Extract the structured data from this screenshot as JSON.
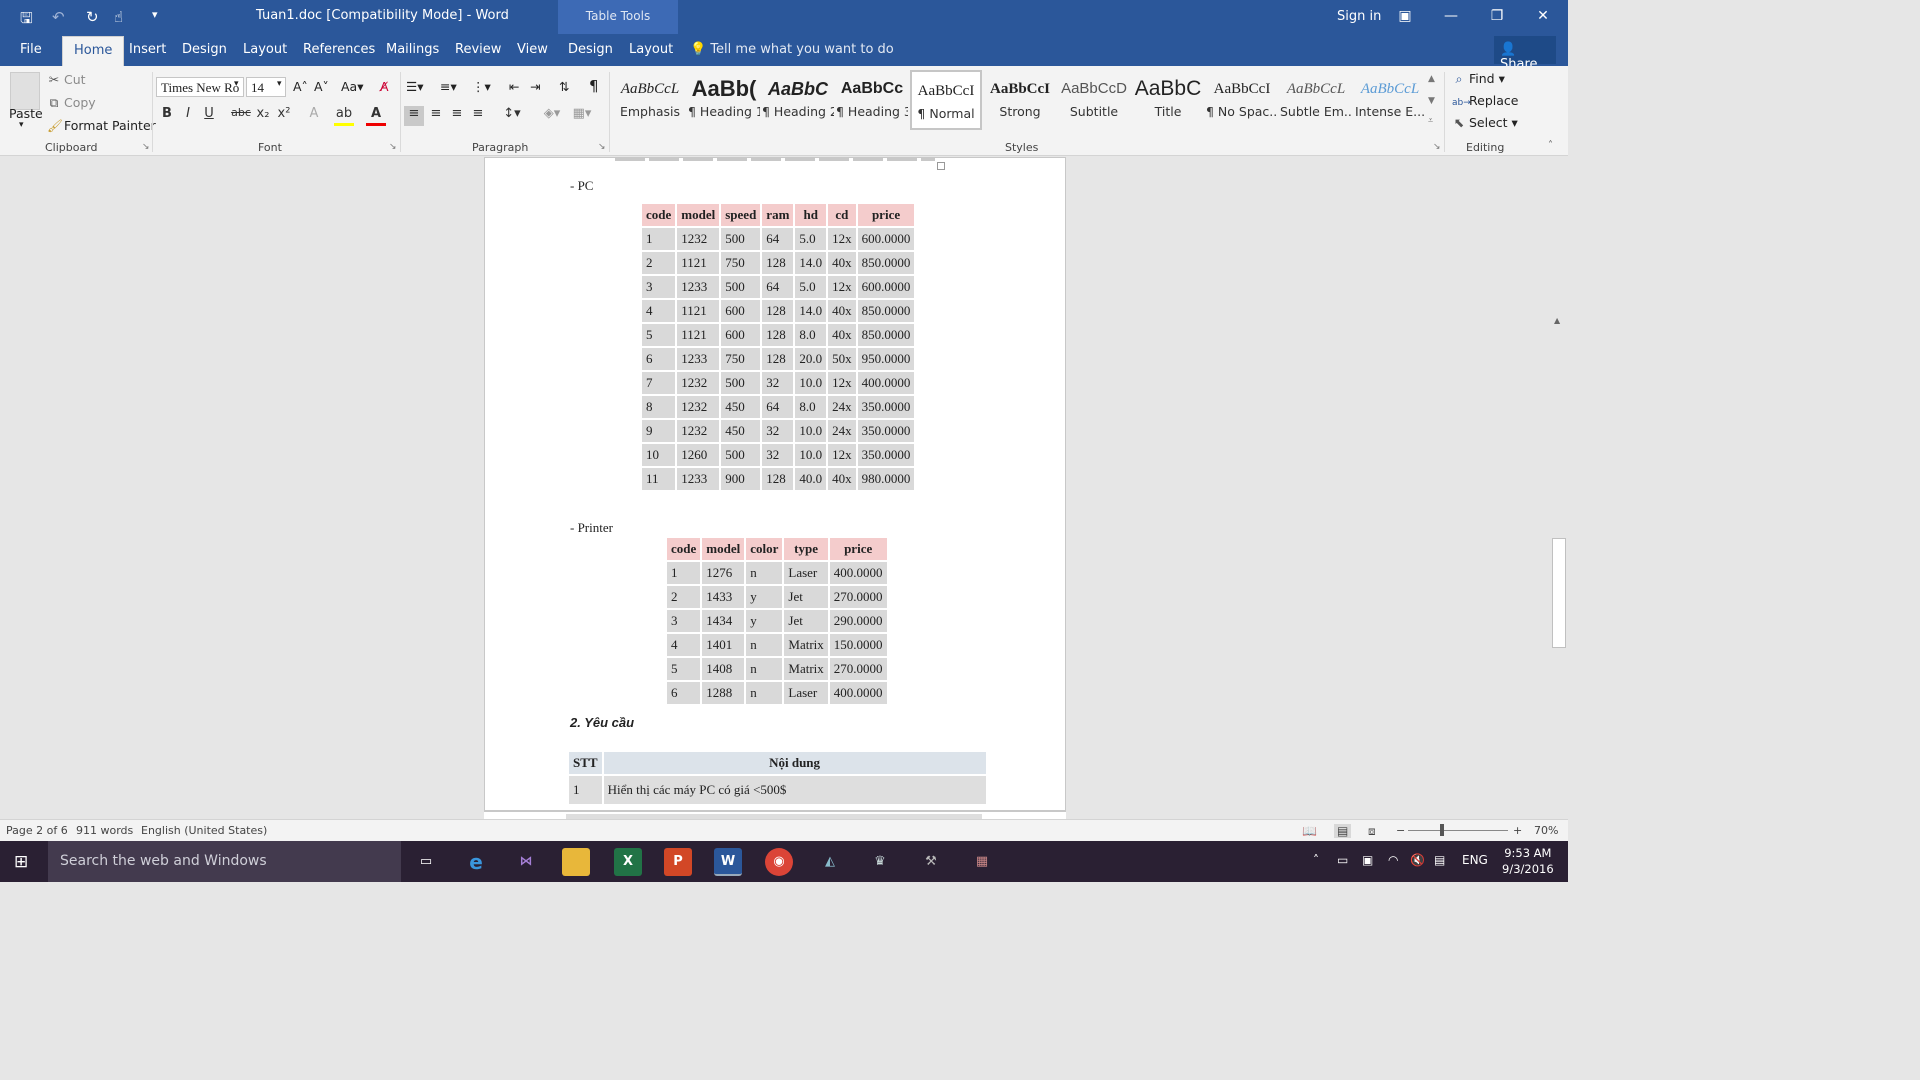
{
  "titlebar": {
    "doc_title": "Tuan1.doc [Compatibility Mode] - Word",
    "table_tools": "Table Tools",
    "sign_in": "Sign in"
  },
  "tabs": [
    "File",
    "Home",
    "Insert",
    "Design",
    "Layout",
    "References",
    "Mailings",
    "Review",
    "View",
    "Design",
    "Layout"
  ],
  "tell_me": "Tell me what you want to do",
  "share": "Share",
  "clipboard": {
    "paste": "Paste",
    "cut": "Cut",
    "copy": "Copy",
    "format_painter": "Format Painter",
    "label": "Clipboard"
  },
  "font": {
    "name": "Times New Ro",
    "size": "14",
    "label": "Font",
    "bold": "B",
    "italic": "I",
    "underline": "U",
    "strike": "abc",
    "sub": "x₂",
    "sup": "x²",
    "case": "Aa"
  },
  "paragraph": {
    "label": "Paragraph",
    "pilcrow": "¶"
  },
  "styles": {
    "label": "Styles",
    "items": [
      {
        "preview": "AaBbCcL",
        "name": "Emphasis"
      },
      {
        "preview": "AaBb(",
        "name": "¶ Heading 1"
      },
      {
        "preview": "AaBbC",
        "name": "¶ Heading 2"
      },
      {
        "preview": "AaBbCc",
        "name": "¶ Heading 3"
      },
      {
        "preview": "AaBbCcI",
        "name": "¶ Normal"
      },
      {
        "preview": "AaBbCcI",
        "name": "Strong"
      },
      {
        "preview": "AaBbCcD",
        "name": "Subtitle"
      },
      {
        "preview": "AaBbC",
        "name": "Title"
      },
      {
        "preview": "AaBbCcI",
        "name": "¶ No Spac..."
      },
      {
        "preview": "AaBbCcL",
        "name": "Subtle Em..."
      },
      {
        "preview": "AaBbCcL",
        "name": "Intense E..."
      }
    ]
  },
  "editing": {
    "label": "Editing",
    "find": "Find",
    "replace": "Replace",
    "select": "Select"
  },
  "doc": {
    "pc_label": "- PC",
    "pc_headers": [
      "code",
      "model",
      "speed",
      "ram",
      "hd",
      "cd",
      "price"
    ],
    "pc_rows": [
      [
        "1",
        "1232",
        "500",
        "64",
        "5.0",
        "12x",
        "600.0000"
      ],
      [
        "2",
        "1121",
        "750",
        "128",
        "14.0",
        "40x",
        "850.0000"
      ],
      [
        "3",
        "1233",
        "500",
        "64",
        "5.0",
        "12x",
        "600.0000"
      ],
      [
        "4",
        "1121",
        "600",
        "128",
        "14.0",
        "40x",
        "850.0000"
      ],
      [
        "5",
        "1121",
        "600",
        "128",
        "8.0",
        "40x",
        "850.0000"
      ],
      [
        "6",
        "1233",
        "750",
        "128",
        "20.0",
        "50x",
        "950.0000"
      ],
      [
        "7",
        "1232",
        "500",
        "32",
        "10.0",
        "12x",
        "400.0000"
      ],
      [
        "8",
        "1232",
        "450",
        "64",
        "8.0",
        "24x",
        "350.0000"
      ],
      [
        "9",
        "1232",
        "450",
        "32",
        "10.0",
        "24x",
        "350.0000"
      ],
      [
        "10",
        "1260",
        "500",
        "32",
        "10.0",
        "12x",
        "350.0000"
      ],
      [
        "11",
        "1233",
        "900",
        "128",
        "40.0",
        "40x",
        "980.0000"
      ]
    ],
    "printer_label": "- Printer",
    "printer_headers": [
      "code",
      "model",
      "color",
      "type",
      "price"
    ],
    "printer_rows": [
      [
        "1",
        "1276",
        "n",
        "Laser",
        "400.0000"
      ],
      [
        "2",
        "1433",
        "y",
        "Jet",
        "270.0000"
      ],
      [
        "3",
        "1434",
        "y",
        "Jet",
        "290.0000"
      ],
      [
        "4",
        "1401",
        "n",
        "Matrix",
        "150.0000"
      ],
      [
        "5",
        "1408",
        "n",
        "Matrix",
        "270.0000"
      ],
      [
        "6",
        "1288",
        "n",
        "Laser",
        "400.0000"
      ]
    ],
    "req_heading": "2. Yêu cầu",
    "req_headers": [
      "STT",
      "Nội dung"
    ],
    "req_rows": [
      [
        "1",
        "Hiển thị các máy PC có giá <500$"
      ]
    ]
  },
  "status": {
    "page": "Page 2 of 6",
    "words": "911 words",
    "lang": "English (United States)",
    "zoom": "70%"
  },
  "taskbar": {
    "search": "Search the web and Windows",
    "lang": "ENG",
    "time": "9:53 AM",
    "date": "9/3/2016"
  }
}
